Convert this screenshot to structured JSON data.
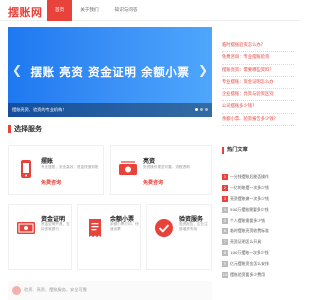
{
  "header": {
    "logo": "摆账网",
    "nav": [
      "首页",
      "关于我们",
      "知识与问答"
    ]
  },
  "banner": {
    "title": "摆账 亮资 资金证明 余额小票",
    "caption": "摆账亮资、验资的专业机构！"
  },
  "notice": [
    "临时摆账验资怎么办?",
    "免费咨询：专业摆账验资",
    "摆账亮资：需要哪些资料？",
    "专业摆账：资金证明怎么办",
    "企业摆账：亮资与验资区别",
    "公司摆账多少钱?",
    "余额小票、验资报告多少钱?"
  ],
  "services": {
    "section_title": "选择服务",
    "cards": [
      {
        "title": "摆账",
        "desc": "专业摆账，安全高效，资金快速到账",
        "price": "免费咨询",
        "icon": "phone-icon"
      },
      {
        "title": "亮资",
        "desc": "亮资操作规范可靠，流程透明",
        "price": "免费咨询",
        "icon": "cash-icon"
      },
      {
        "title": "资金证明",
        "desc": "资金证明开具，支持多家银行",
        "price": "",
        "icon": "money-icon"
      },
      {
        "title": "余额小票",
        "desc": "余额小票打印，快速出票",
        "price": "",
        "icon": "receipt-icon"
      },
      {
        "title": "验资服务",
        "desc": "验资报告，企业注册增资专用",
        "price": "",
        "icon": "check-icon"
      }
    ]
  },
  "hot": {
    "title": "热门文章",
    "items": [
      "一分钱摆账后能否操作",
      "一亿的账摆一次多少钱",
      "亮资摆账做一次多少钱",
      "500万摆账需要多少钱",
      "个人摆账需要多少钱",
      "临时摆账亮资收费标准",
      "亮资证明怎么开具",
      "100万摆账一次多少钱",
      "亿元摆账资金怎么安排",
      "摆账验资要多少费用"
    ]
  },
  "bottom": {
    "text": "验资、亮资、摆账服务，安全可靠"
  },
  "colors": {
    "accent": "#e8423a",
    "banner": "#3d92f7"
  }
}
